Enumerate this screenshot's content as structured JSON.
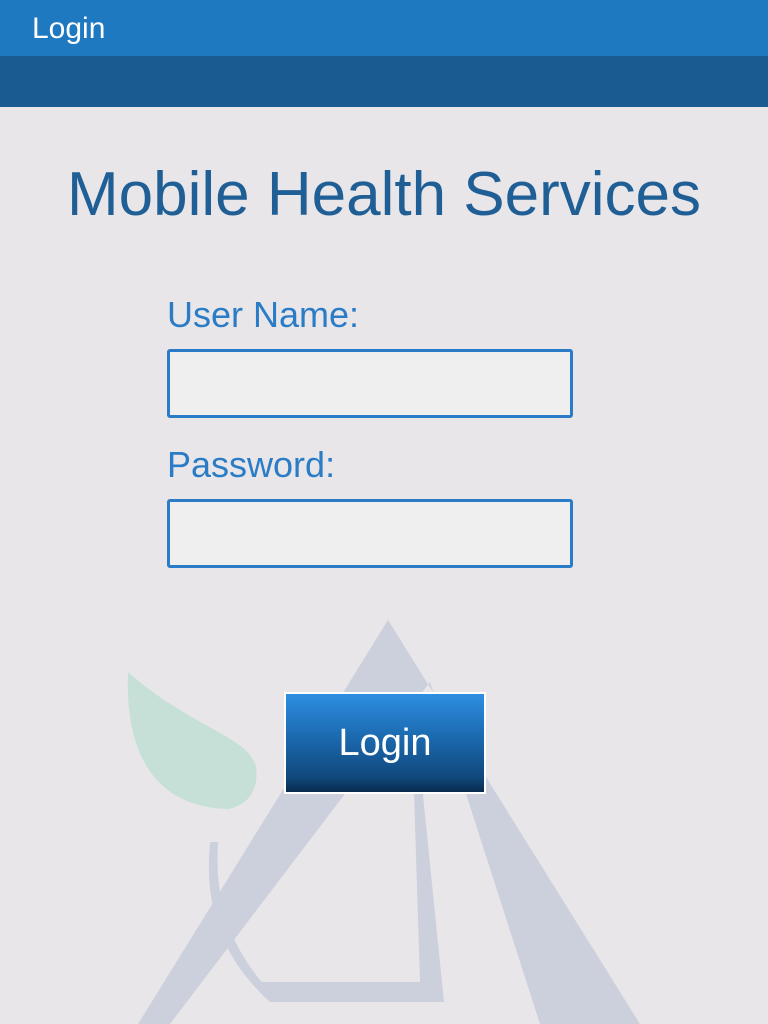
{
  "window": {
    "title": "Login"
  },
  "main": {
    "app_title": "Mobile Health Services",
    "username_label": "User Name:",
    "username_value": "",
    "password_label": "Password:",
    "password_value": "",
    "login_button_label": "Login"
  },
  "colors": {
    "titlebar": "#1f79c1",
    "subbar": "#1a5c91",
    "background": "#e8e6e8",
    "accent": "#2a7cc7",
    "title_text": "#1f5f96",
    "watermark_triangle": "#ccd0dd",
    "watermark_leaf": "#c6e0d8"
  },
  "icons": {
    "watermark": "pyramid-leaf-logo"
  }
}
